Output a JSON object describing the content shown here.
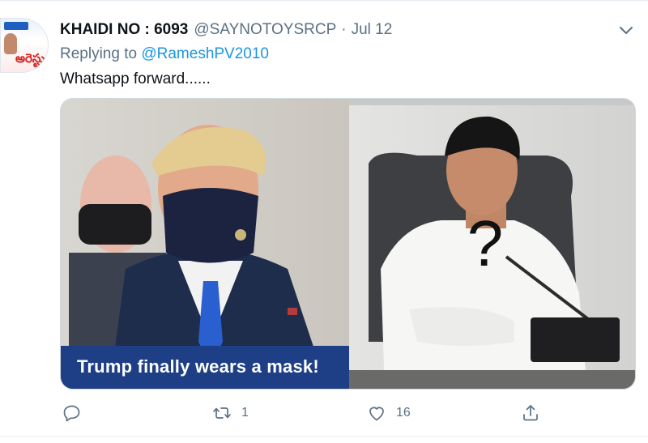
{
  "tweet": {
    "display_name": "KHAIDI NO : 6093",
    "handle": "@SAYNOTOYSRCP",
    "separator": "·",
    "date": "Jul 12",
    "reply_prefix": "Replying to",
    "reply_to": "@RameshPV2010",
    "text": "Whatsapp forward......",
    "avatar_text": "అరెస్టు",
    "media": {
      "left_caption": "Trump finally wears a mask!",
      "overlay_mark": "?"
    },
    "actions": {
      "reply_icon": "reply-icon",
      "retweet_icon": "retweet-icon",
      "retweet_count": "1",
      "like_icon": "heart-icon",
      "like_count": "16",
      "share_icon": "share-icon"
    }
  },
  "colors": {
    "name": "#0f1419",
    "secondary": "#5b7083",
    "link": "#1b95e0",
    "divider": "#e6ecf0",
    "caption_bar": "#1e3f86"
  }
}
